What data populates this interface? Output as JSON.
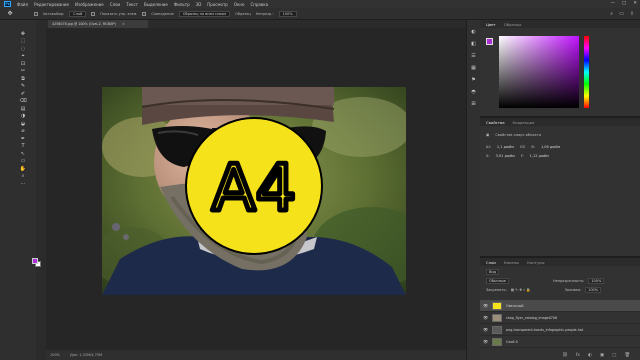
{
  "menubar": {
    "logo": "Ps",
    "items": [
      "Файл",
      "Редактирование",
      "Изображение",
      "Слои",
      "Текст",
      "Выделение",
      "Фильтр",
      "3D",
      "Просмотр",
      "Окно",
      "Справка"
    ],
    "minimize": "—",
    "maximize": "□",
    "close": "✕"
  },
  "options": {
    "tool_glyph": "✥",
    "autoselect_label": "Автовыбор:",
    "autoselect_value": "Слой",
    "transform_label": "Показать упр. элем.",
    "snap_label": "Совпадение",
    "align_label": "Образец по всем слоям",
    "mode_label": "Образец",
    "size_label": "Непрозр.:",
    "size_value": "100%"
  },
  "document": {
    "tab_title": "4258078.jpg @ 100% (Oval-2, RGB/8*)",
    "tab_close": "×",
    "badge_text": "A4",
    "status_zoom": "100%",
    "status_info": "Док: 1,32М/4,75М"
  },
  "tools": [
    "✥",
    "⬚",
    "◌",
    "⌖",
    "⊡",
    "✂",
    "⧉",
    "✎",
    "✐",
    "⌫",
    "▤",
    "◑",
    "◒",
    "⌀",
    "✒",
    "T",
    "↖",
    "▭",
    "✋",
    "⌕",
    "⋯"
  ],
  "swatches": {
    "foreground": "#ad2fd6",
    "background": "#ffffff"
  },
  "iconstrip": [
    "◐",
    "◧",
    "☰",
    "▦",
    "⚑",
    "◓",
    "⊞"
  ],
  "color_panel": {
    "tabs": [
      "Цвет",
      "Образцы"
    ],
    "hue_color": "#c012ff"
  },
  "properties_panel": {
    "tabs": [
      "Свойства",
      "Коррекция"
    ],
    "header": "Свойства смарт-объекта",
    "w_label": "Ш:",
    "w_value": "1,1 дюйм",
    "link_label": "GO",
    "h_label": "В:",
    "h_value": "1,06 дюйм",
    "x_label": "X:",
    "x_value": "3,91 дюйм",
    "y_label": "Y:",
    "y_value": "1,12 дюйм"
  },
  "layers_panel": {
    "tabs": [
      "Слои",
      "Каналы",
      "Контуры"
    ],
    "filter_label": "Вид",
    "blend_mode": "Обычные",
    "opacity_label": "Непрозрачность:",
    "opacity_value": "100%",
    "lock_label": "Закрепить:",
    "fill_label": "Заливка:",
    "fill_value": "100%",
    "eye": "👁",
    "layers": [
      {
        "name": "Овальный",
        "thumb": "#f6e21a"
      },
      {
        "name": "shop_flyer_catalog_image0708",
        "thumb": "#9a8f7c"
      },
      {
        "name": "png-transparent-hands_infographic-people-hat",
        "thumb": "#5a5a5a"
      },
      {
        "name": "Слой 0",
        "thumb": "#6b7a4c"
      }
    ],
    "footer_icons": [
      "⛓",
      "fx",
      "◐",
      "▣",
      "□",
      "🗑"
    ]
  }
}
